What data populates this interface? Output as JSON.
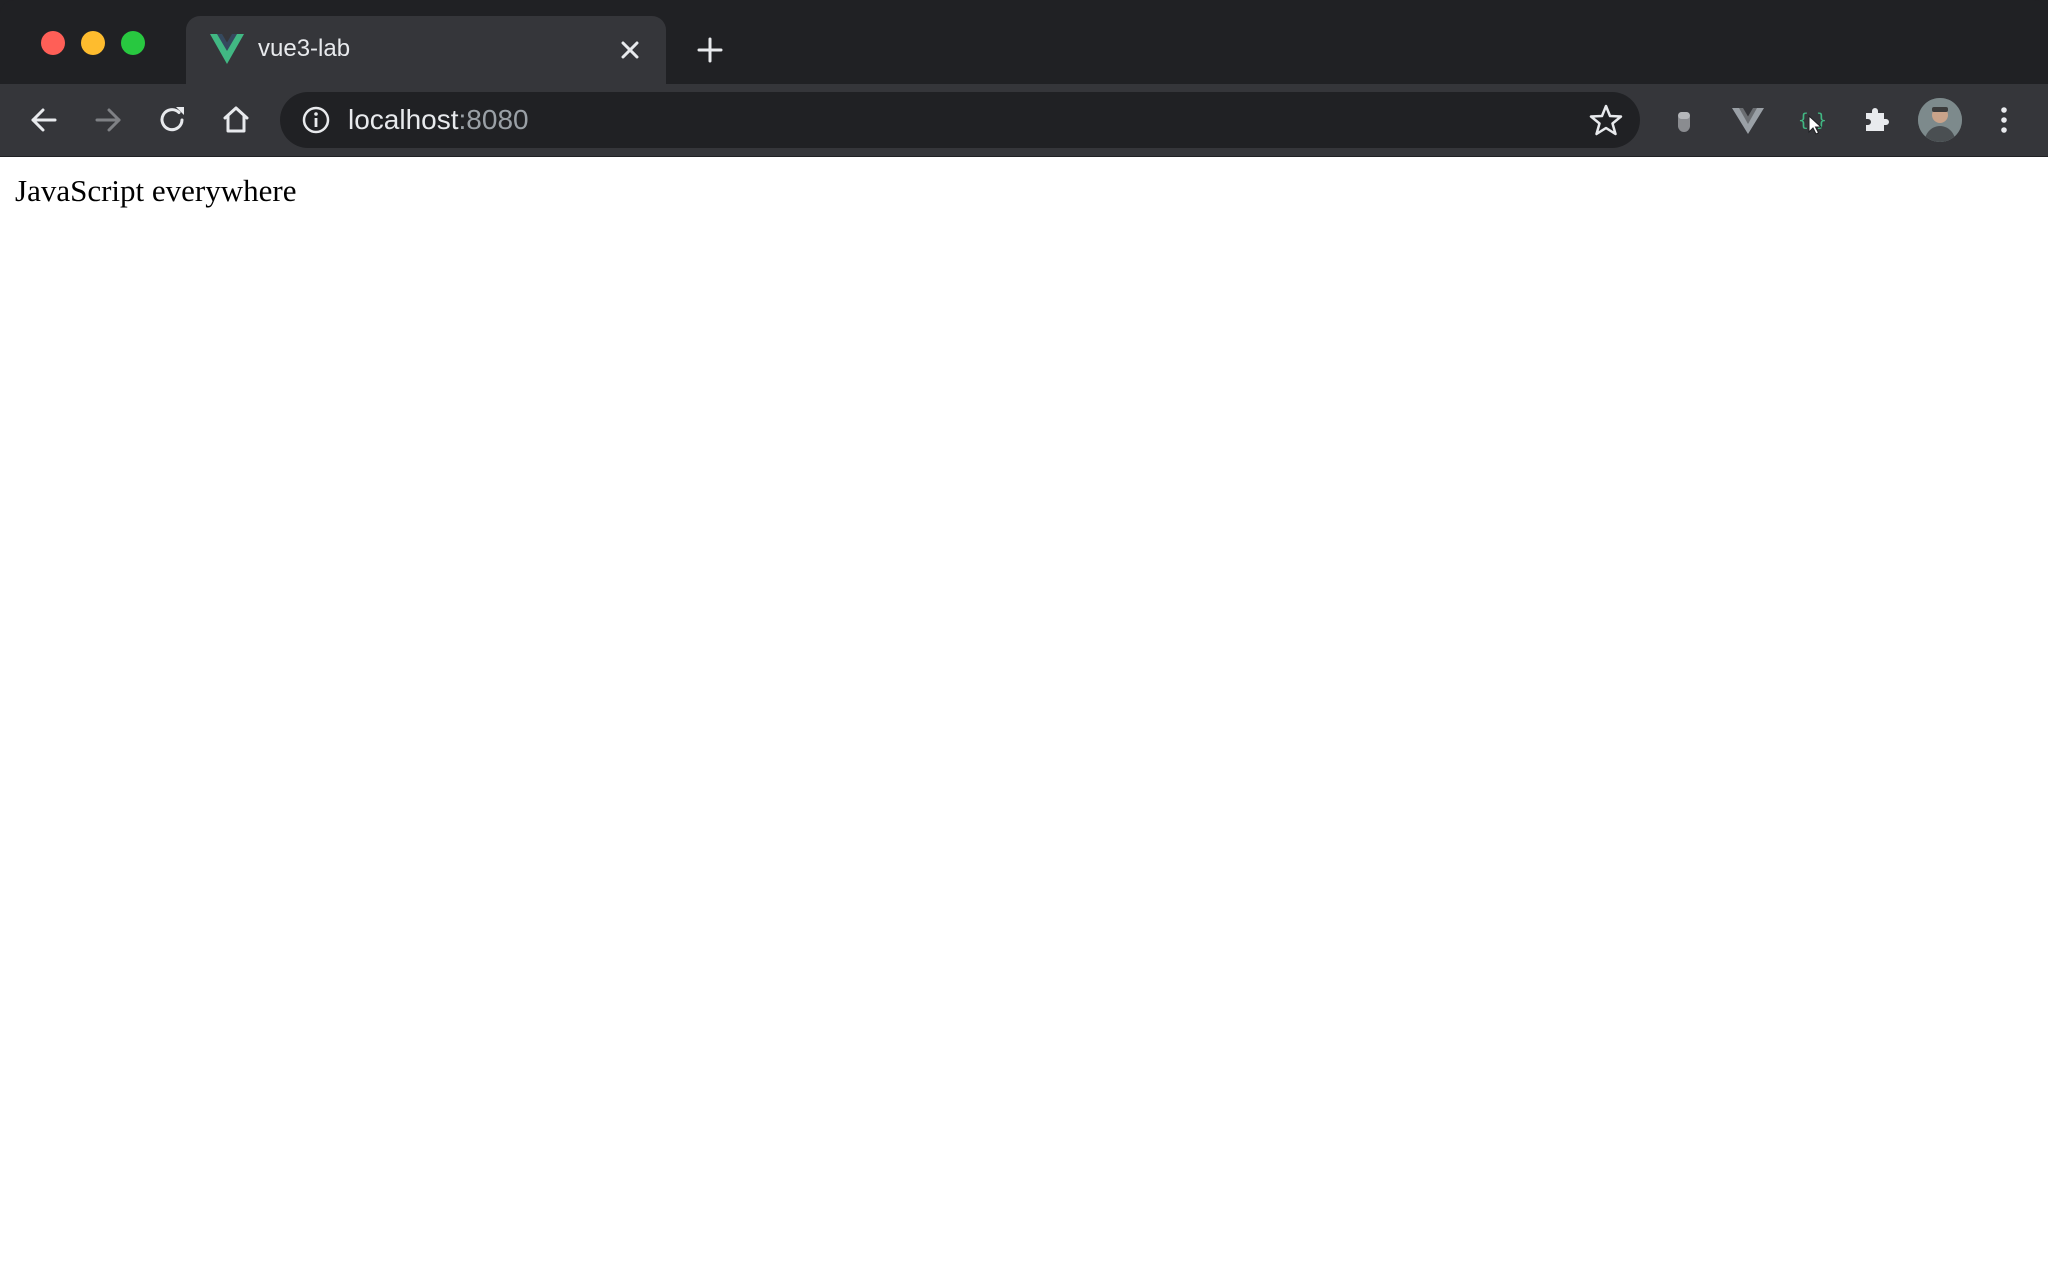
{
  "window": {
    "traffic_lights": {
      "close_color": "#ff5f57",
      "minimize_color": "#febc2e",
      "maximize_color": "#28c840"
    }
  },
  "tabs": [
    {
      "title": "vue3-lab",
      "favicon": "vue-logo-icon",
      "active": true
    }
  ],
  "toolbar": {
    "back_icon": "arrow-left-icon",
    "forward_icon": "arrow-right-icon",
    "reload_icon": "reload-icon",
    "home_icon": "home-icon",
    "extensions": [
      "gray-extension-icon",
      "vue-devtools-icon",
      "json-viewer-icon",
      "puzzle-icon"
    ],
    "menu_icon": "kebab-menu-icon"
  },
  "omnibox": {
    "host": "localhost",
    "port": ":8080",
    "site_info_icon": "info-icon",
    "bookmark_icon": "star-icon"
  },
  "page": {
    "text": "JavaScript everywhere"
  },
  "colors": {
    "tab_strip": "#202124",
    "toolbar": "#35363a",
    "omnibox": "#202124",
    "vue_green": "#41b883",
    "vue_dark": "#35495e",
    "content_bg": "#ffffff"
  }
}
